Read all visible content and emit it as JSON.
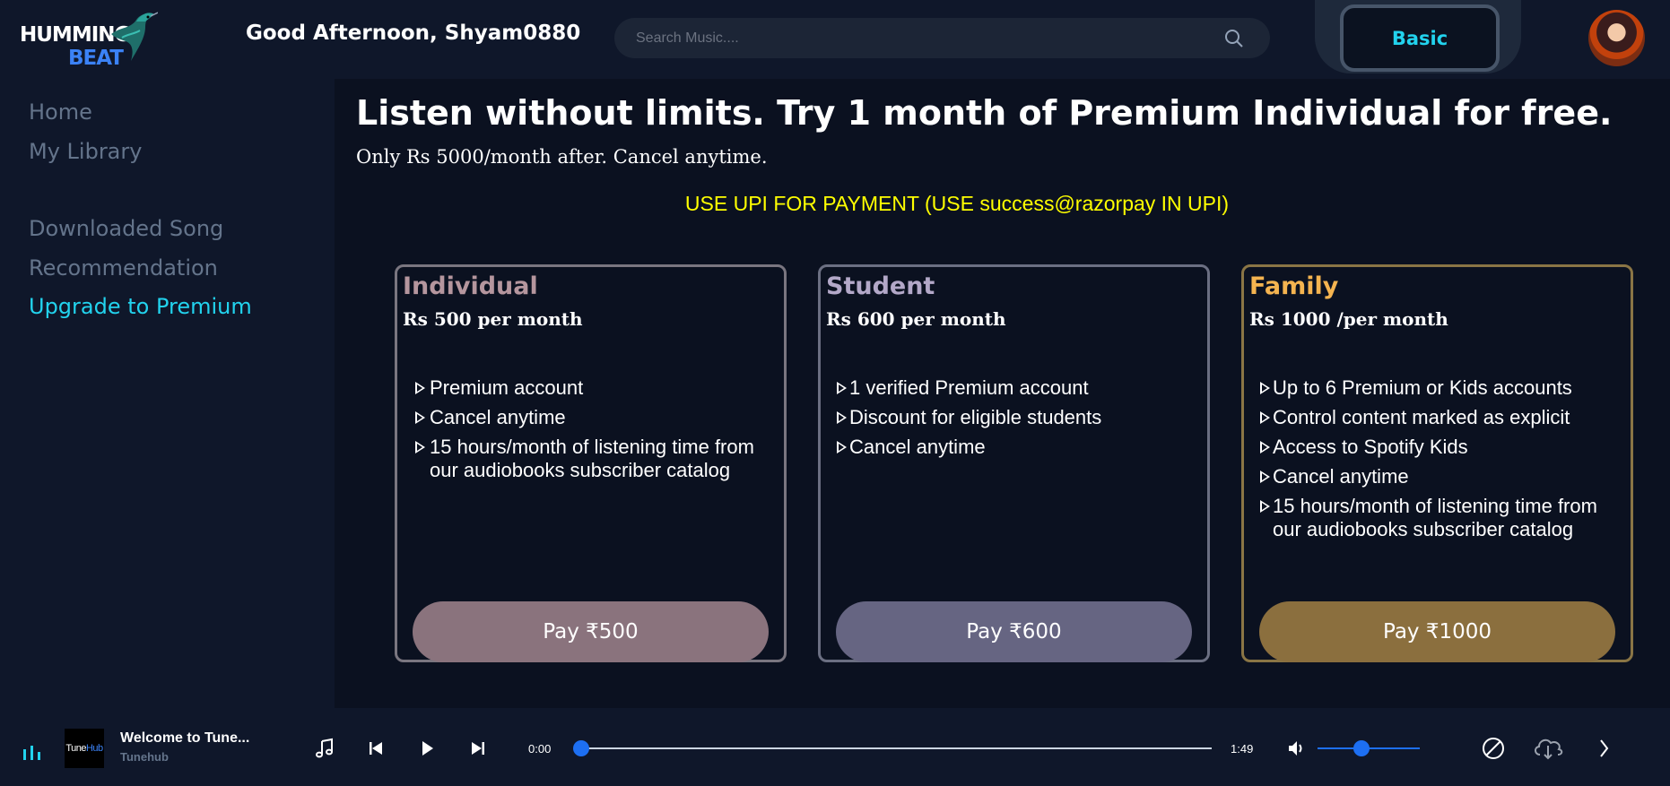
{
  "header": {
    "logo_line1": "HUMMING",
    "logo_line2": "BEAT",
    "greeting": "Good Afternoon, Shyam0880",
    "search_placeholder": "Search Music....",
    "plan_label": "Basic"
  },
  "sidebar": {
    "items": [
      {
        "label": "Home"
      },
      {
        "label": "My Library"
      },
      {
        "label": "Downloaded Song"
      },
      {
        "label": "Recommendation"
      },
      {
        "label": "Upgrade to Premium",
        "active": true
      }
    ]
  },
  "main": {
    "headline": "Listen without limits. Try 1 month of Premium Individual for free.",
    "subheadline": "Only Rs 5000/month after. Cancel anytime.",
    "upi_notice": "USE UPI FOR PAYMENT (USE success@razorpay IN UPI)",
    "plans": [
      {
        "title": "Individual",
        "price": "Rs 500 per month",
        "features": [
          "Premium account",
          "Cancel anytime",
          "15 hours/month of listening time from our audiobooks subscriber catalog"
        ],
        "button": "Pay ₹500",
        "accent": "#b5969e",
        "border": "#7a7680",
        "button_color": "#8a737d"
      },
      {
        "title": "Student",
        "price": "Rs 600 per month",
        "features": [
          "1 verified Premium account",
          "Discount for eligible students",
          "Cancel anytime"
        ],
        "button": "Pay ₹600",
        "accent": "#b3a8c8",
        "border": "#6b6f82",
        "button_color": "#666582"
      },
      {
        "title": "Family",
        "price": "Rs 1000 /per month",
        "features": [
          "Up to 6 Premium or Kids accounts",
          "Control content marked as explicit",
          "Access to Spotify Kids",
          "Cancel anytime",
          "15 hours/month of listening time from our audiobooks subscriber catalog"
        ],
        "button": "Pay ₹1000",
        "accent": "#f5b450",
        "border": "#8a7545",
        "button_color": "#8b6f3e"
      }
    ]
  },
  "player": {
    "thumb_text_1": "Tune",
    "thumb_text_2": "Hub",
    "track_title": "Welcome to Tune...",
    "track_artist": "Tunehub",
    "time_current": "0:00",
    "time_total": "1:49",
    "progress": 0,
    "volume": 0.43
  }
}
